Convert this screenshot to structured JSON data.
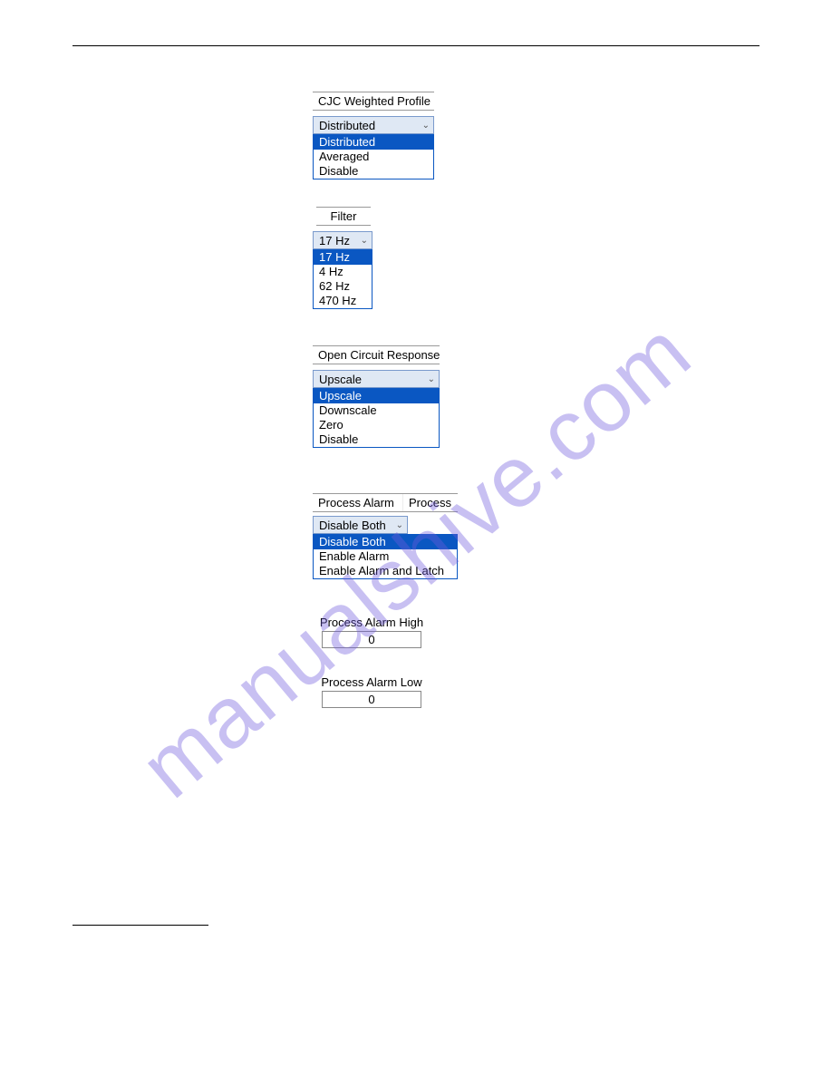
{
  "watermark": "manualshive.com",
  "cjc": {
    "header": "CJC Weighted Profile",
    "selected": "Distributed",
    "options": [
      "Distributed",
      "Averaged",
      "Disable"
    ]
  },
  "filter": {
    "header": "Filter",
    "selected": "17 Hz",
    "options": [
      "17 Hz",
      "4 Hz",
      "62 Hz",
      "470 Hz"
    ]
  },
  "ocr": {
    "header": "Open Circuit Response",
    "selected": "Upscale",
    "options": [
      "Upscale",
      "Downscale",
      "Zero",
      "Disable"
    ]
  },
  "process_alarm": {
    "headers": [
      "Process Alarm",
      "Process"
    ],
    "selected": "Disable Both",
    "options": [
      "Disable Both",
      "Enable Alarm",
      "Enable Alarm and Latch"
    ]
  },
  "pa_high": {
    "label": "Process Alarm High",
    "value": "0"
  },
  "pa_low": {
    "label": "Process Alarm Low",
    "value": "0"
  }
}
